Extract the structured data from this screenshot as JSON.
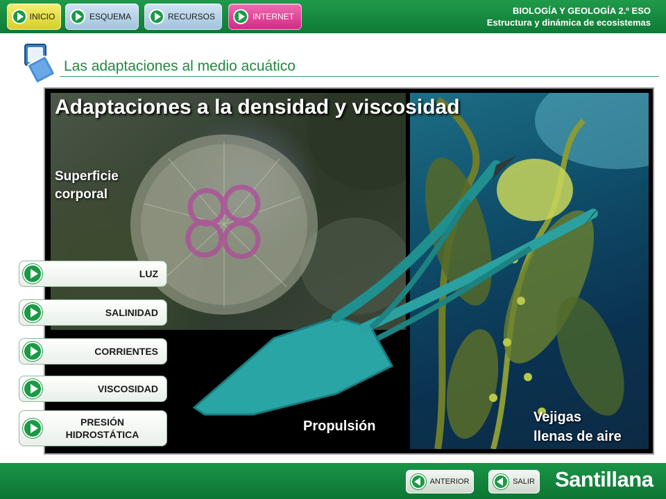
{
  "nav": {
    "inicio": "INICIO",
    "esquema": "ESQUEMA",
    "recursos": "RECURSOS",
    "internet": "INTERNET"
  },
  "course": {
    "subject": "BIOLOGÍA Y GEOLOGÍA 2.º ESO",
    "unit": "Estructura y dinámica de ecosistemas"
  },
  "section": {
    "title": "Las adaptaciones al medio acuático"
  },
  "panel": {
    "title": "Adaptaciones a la densidad y viscosidad",
    "label_surface": [
      "Superficie",
      "corporal"
    ],
    "label_propulsion": "Propulsión",
    "label_bladders": [
      "Vejigas",
      "llenas de aire"
    ]
  },
  "topics": [
    "LUZ",
    "SALINIDAD",
    "CORRIENTES",
    "VISCOSIDAD",
    [
      "PRESIÓN",
      "HIDROSTÁTICA"
    ]
  ],
  "footer": {
    "anterior": "ANTERIOR",
    "salir": "SALIR",
    "brand": "Santillana"
  },
  "colors": {
    "brand_green": "#0f7a36",
    "accent_green": "#1a9a45",
    "inicio_yellow": "#e8e14a",
    "esquema_blue": "#b9d6ea",
    "internet_pink": "#e0489a",
    "title_green": "#1f8a3e"
  },
  "icons": {
    "nav": "play-icon",
    "topics": "play-icon",
    "footer": "back-arrow-icon",
    "section": "stacked-windows-icon"
  }
}
